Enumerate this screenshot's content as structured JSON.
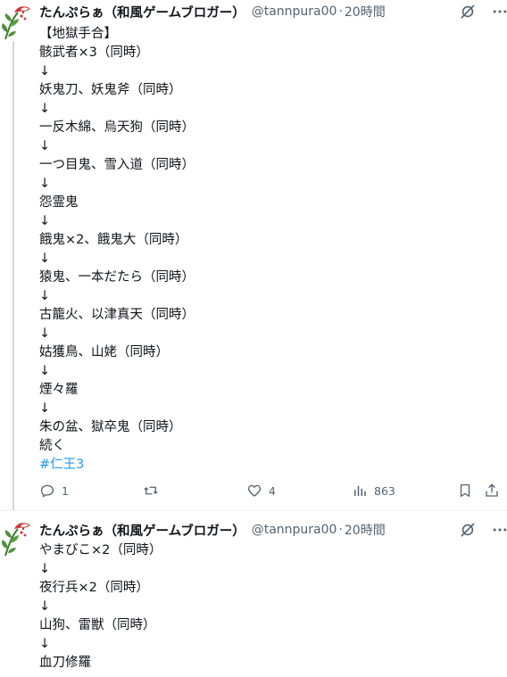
{
  "tweets": [
    {
      "author": {
        "display_name": "たんぷらぁ（和風ゲームブロガー）",
        "handle": "@tannpura00",
        "separator": "·",
        "time": "20時間"
      },
      "icons": {
        "grok": "grok-icon",
        "more": "more-icon"
      },
      "lines": [
        "【地獄手合】",
        "骸武者×3（同時）",
        "↓",
        "妖鬼刀、妖鬼斧（同時）",
        "↓",
        "一反木綿、烏天狗（同時）",
        "↓",
        "一つ目鬼、雪入道（同時）",
        "↓",
        "怨霊鬼",
        "↓",
        "餓鬼×2、餓鬼大（同時）",
        "↓",
        "猿鬼、一本だたら（同時）",
        "↓",
        "古籠火、以津真天（同時）",
        "↓",
        "姑獲鳥、山姥（同時）",
        "↓",
        "煙々羅",
        "↓",
        "朱の盆、獄卒鬼（同時）",
        "続く"
      ],
      "hashtag": "#仁王3",
      "metrics": {
        "replies": "1",
        "reposts": "",
        "likes": "4",
        "views": "863"
      }
    },
    {
      "author": {
        "display_name": "たんぷらぁ（和風ゲームブロガー）",
        "handle": "@tannpura00",
        "separator": "·",
        "time": "20時間"
      },
      "lines": [
        "やまびこ×2（同時）",
        "↓",
        "夜行兵×2（同時）",
        "↓",
        "山狗、雷獣（同時）",
        "↓",
        "血刀修羅"
      ]
    }
  ],
  "colors": {
    "text": "#0f1419",
    "secondary": "#536471",
    "link": "#1d9bf0",
    "thread_line": "#cfd9de"
  }
}
